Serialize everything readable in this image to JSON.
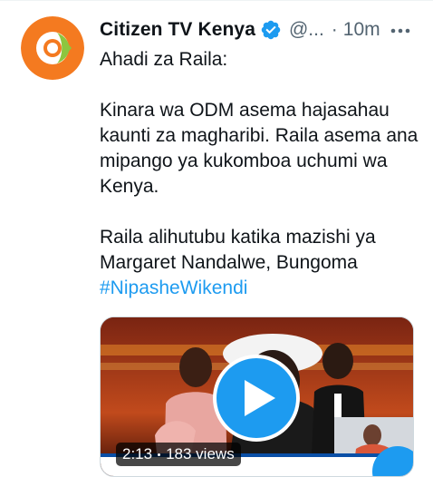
{
  "tweet": {
    "display_name": "Citizen TV Kenya",
    "handle": "@...",
    "separator": "·",
    "time": "10m",
    "verified": true,
    "lines": {
      "title": "Ahadi za Raila:",
      "para2": "Kinara wa ODM asema hajasahau kaunti za magharibi. Raila asema ana mipango ya kukomboa uchumi wa Kenya.",
      "para3": "Raila alihutubu katika mazishi ya Margaret Nandalwe, Bungoma",
      "hashtag": "#NipasheWikendi"
    },
    "media": {
      "duration": "2:13",
      "views": "183 views"
    }
  },
  "colors": {
    "accent": "#1d9bf0",
    "text": "#0f1419",
    "secondary": "#536471",
    "logo_orange": "#f47a20",
    "logo_green": "#8cc63f"
  },
  "icons": {
    "verified": "verified-badge-icon",
    "more": "more-options-icon",
    "play": "play-icon"
  }
}
